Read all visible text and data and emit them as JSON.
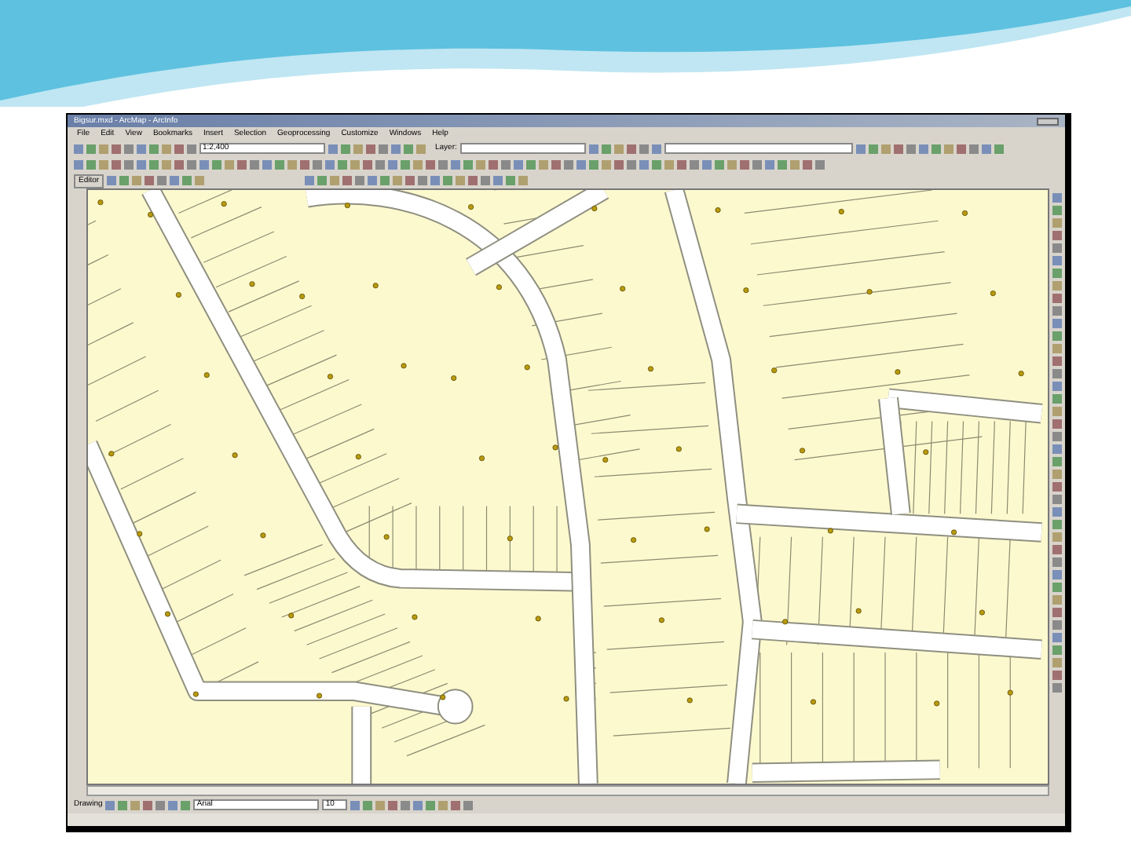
{
  "window": {
    "title": "Bigsur.mxd - ArcMap - ArcInfo"
  },
  "menu": [
    "File",
    "Edit",
    "View",
    "Bookmarks",
    "Insert",
    "Selection",
    "Geoprocessing",
    "Customize",
    "Windows",
    "Help"
  ],
  "standard_toolbar": {
    "scale": "1:2,400"
  },
  "toolbar_rows": [
    {
      "label": "Layer:"
    },
    {
      "label": "Editor"
    }
  ],
  "drawing_toolbar": {
    "label": "Drawing",
    "font": "Arial",
    "size": "10"
  }
}
